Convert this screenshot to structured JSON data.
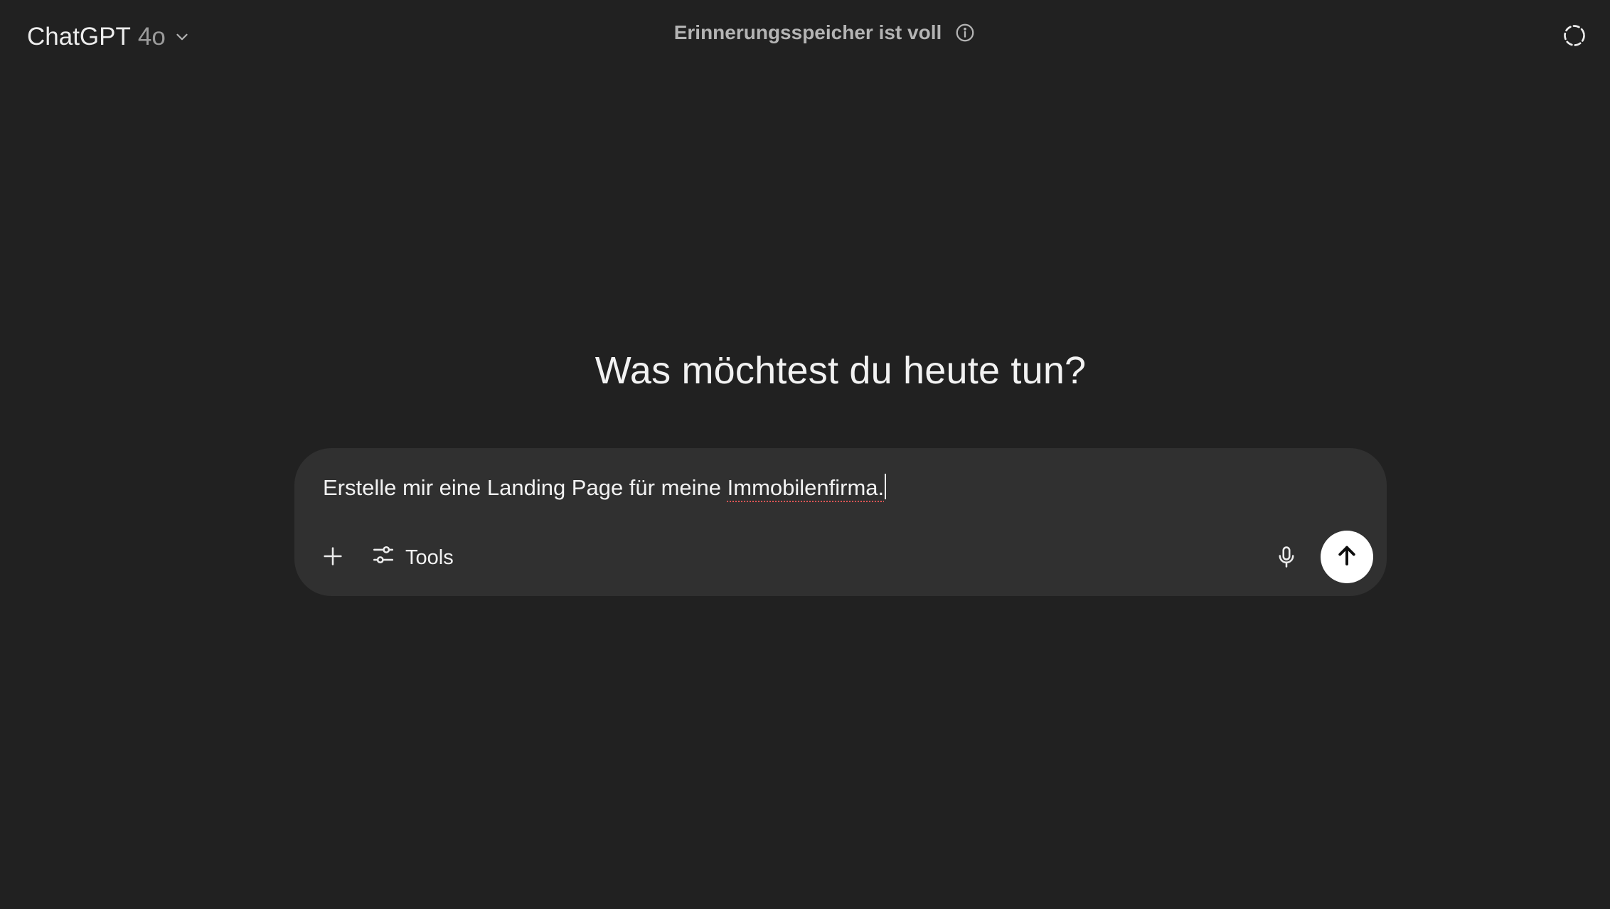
{
  "header": {
    "model_name": "ChatGPT",
    "model_version": "4o",
    "model_menu_icon": "chevron-down-icon",
    "memory_notice": "Erinnerungsspeicher ist voll",
    "memory_info_icon": "info-icon",
    "temporary_chat_icon": "temporary-chat-icon"
  },
  "main": {
    "headline": "Was möchtest du heute tun?"
  },
  "composer": {
    "input_text_before": "Erstelle mir eine Landing Page für meine ",
    "input_text_misspelled": "Immobilenfirma.",
    "plus_icon": "plus-icon",
    "tools_icon": "sliders-icon",
    "tools_label": "Tools",
    "mic_icon": "microphone-icon",
    "send_icon": "arrow-up-icon"
  },
  "colors": {
    "background": "#212121",
    "composer_background": "#303030",
    "text_primary": "#f2f2f2",
    "text_muted": "#9b9b9b",
    "send_button": "#ffffff",
    "spellcheck_underline": "#e25555"
  }
}
